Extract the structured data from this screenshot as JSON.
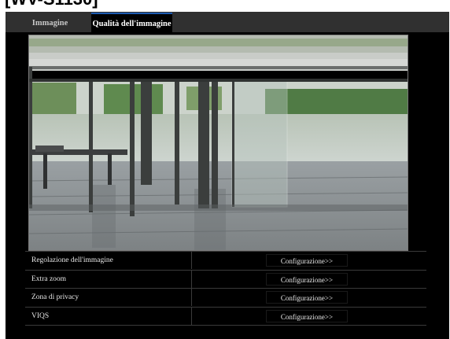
{
  "page": {
    "title": "[WV-S1130]"
  },
  "tabs": [
    {
      "label": "Immagine",
      "active": false
    },
    {
      "label": "Qualità dell'immagine",
      "active": true
    }
  ],
  "colors": {
    "accent": "#1c5ab0",
    "panel_bg": "#000000"
  },
  "settings": {
    "rows": [
      {
        "label": "Regolazione dell'immagine",
        "button": "Configurazione>>"
      },
      {
        "label": "Extra zoom",
        "button": "Configurazione>>"
      },
      {
        "label": "Zona di privacy",
        "button": "Configurazione>>"
      },
      {
        "label": "VIQS",
        "button": "Configurazione>>"
      }
    ]
  }
}
